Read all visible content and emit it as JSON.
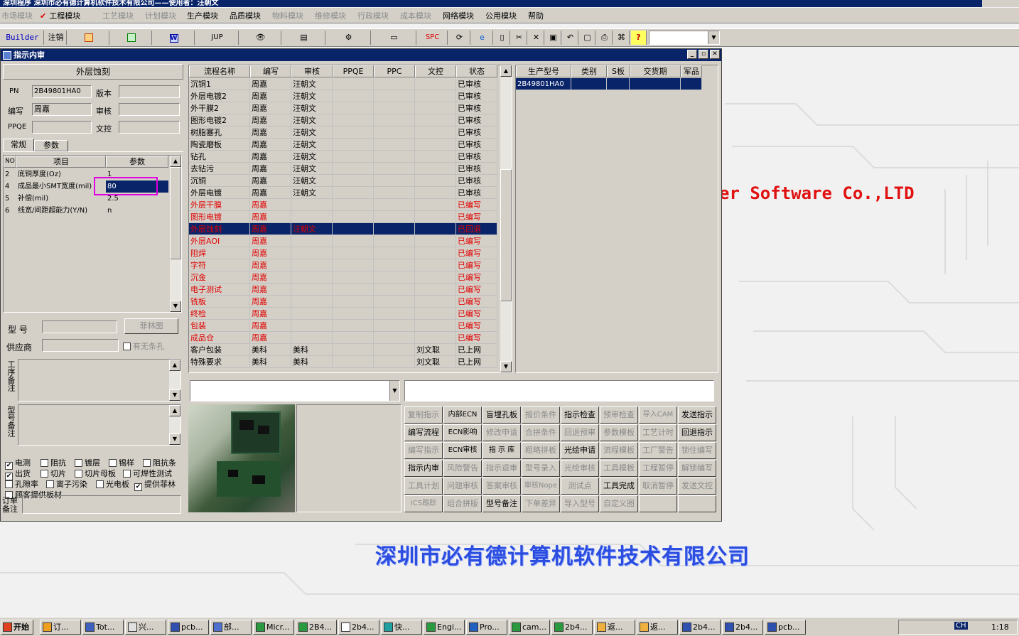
{
  "app": {
    "title": "深圳程序  深圳市必有德计算机软件技术有限公司——使用者：汪朝文"
  },
  "menu": [
    {
      "label": "市场模块",
      "dim": true
    },
    {
      "label": "工程模块",
      "dim": false,
      "checked": true
    },
    {
      "label": "工艺模块",
      "dim": true
    },
    {
      "label": "计划模块",
      "dim": true
    },
    {
      "label": "生产模块",
      "dim": false
    },
    {
      "label": "品质模块",
      "dim": false
    },
    {
      "label": "物料模块",
      "dim": true
    },
    {
      "label": "维修模块",
      "dim": true
    },
    {
      "label": "行政模块",
      "dim": true
    },
    {
      "label": "成本模块",
      "dim": true
    },
    {
      "label": "网络模块",
      "dim": false
    },
    {
      "label": "公用模块",
      "dim": false
    },
    {
      "label": "帮助",
      "dim": false
    }
  ],
  "toolbar": {
    "builder": "Builder",
    "logout": "注销",
    "jup": "JUP",
    "spc": "SPC",
    "icons": [
      "excel-icon",
      "excel2-icon",
      "word-icon",
      "eye-icon",
      "database-icon",
      "network-icon",
      "printer-icon",
      "refresh-icon",
      "ie-icon",
      "new-file-icon",
      "cut-icon",
      "close-x-icon",
      "save-icon",
      "undo-icon",
      "preview-icon",
      "print-icon",
      "binoculars-icon",
      "help-icon"
    ]
  },
  "child_window": {
    "title": "指示内审"
  },
  "left": {
    "section_title": "外层蚀刻",
    "pn_label": "PN",
    "pn_value": "2B49801HA0",
    "version_label": "版本",
    "writer_label": "编写",
    "writer_value": "周嘉",
    "reviewer_label": "审核",
    "ppqe_label": "PPQE",
    "proofread_label": "文控",
    "tabs": [
      "常规",
      "参数"
    ],
    "param_headers": [
      "NO",
      "项目",
      "参数"
    ],
    "params": [
      {
        "no": "2",
        "item": "底铜厚度(Oz)",
        "value": "1"
      },
      {
        "no": "4",
        "item": "成品最小SMT宽度(mil)",
        "value": "80"
      },
      {
        "no": "5",
        "item": "补偿(mil)",
        "value": "2.5"
      },
      {
        "no": "6",
        "item": "线宽/间距超能力(Y/N)",
        "value": "n"
      }
    ],
    "model_label": "型  号",
    "film_button": "菲林图",
    "supplier_label": "供应商",
    "no_slot_hole": "有无条孔",
    "process_note_label": "工序备注",
    "model_note_label": "型号备注",
    "order_note_label": "订单备注",
    "checks": [
      {
        "label": "电测",
        "checked": true
      },
      {
        "label": "阻抗",
        "checked": false
      },
      {
        "label": "镀层",
        "checked": false
      },
      {
        "label": "锡样",
        "checked": false
      },
      {
        "label": "阻抗条",
        "checked": false
      },
      {
        "label": "出货",
        "checked": true
      },
      {
        "label": "切片",
        "checked": false
      },
      {
        "label": "切片母板",
        "checked": false
      },
      {
        "label": "可焊性测试",
        "checked": false
      },
      {
        "label": "孔隙率",
        "checked": false
      },
      {
        "label": "离子污染",
        "checked": false
      },
      {
        "label": "光电板",
        "checked": false
      },
      {
        "label": "提供菲林",
        "checked": true
      },
      {
        "label": "顾客提供板材",
        "checked": false
      }
    ]
  },
  "process_grid": {
    "headers": [
      "流程名称",
      "编写",
      "审核",
      "PPQE",
      "PPC",
      "文控",
      "状态"
    ],
    "rows": [
      {
        "name": "沉铜1",
        "writer": "周嘉",
        "reviewer": "汪朝文",
        "ppqe": "",
        "ppc": "",
        "doc": "",
        "status": "已审核",
        "red": false
      },
      {
        "name": "外层电镀2",
        "writer": "周嘉",
        "reviewer": "汪朝文",
        "ppqe": "",
        "ppc": "",
        "doc": "",
        "status": "已审核",
        "red": false
      },
      {
        "name": "外干膜2",
        "writer": "周嘉",
        "reviewer": "汪朝文",
        "ppqe": "",
        "ppc": "",
        "doc": "",
        "status": "已审核",
        "red": false
      },
      {
        "name": "图形电镀2",
        "writer": "周嘉",
        "reviewer": "汪朝文",
        "ppqe": "",
        "ppc": "",
        "doc": "",
        "status": "已审核",
        "red": false
      },
      {
        "name": "树脂塞孔",
        "writer": "周嘉",
        "reviewer": "汪朝文",
        "ppqe": "",
        "ppc": "",
        "doc": "",
        "status": "已审核",
        "red": false
      },
      {
        "name": "陶瓷磨板",
        "writer": "周嘉",
        "reviewer": "汪朝文",
        "ppqe": "",
        "ppc": "",
        "doc": "",
        "status": "已审核",
        "red": false
      },
      {
        "name": "钻孔",
        "writer": "周嘉",
        "reviewer": "汪朝文",
        "ppqe": "",
        "ppc": "",
        "doc": "",
        "status": "已审核",
        "red": false
      },
      {
        "name": "去钻污",
        "writer": "周嘉",
        "reviewer": "汪朝文",
        "ppqe": "",
        "ppc": "",
        "doc": "",
        "status": "已审核",
        "red": false
      },
      {
        "name": "沉铜",
        "writer": "周嘉",
        "reviewer": "汪朝文",
        "ppqe": "",
        "ppc": "",
        "doc": "",
        "status": "已审核",
        "red": false
      },
      {
        "name": "外层电镀",
        "writer": "周嘉",
        "reviewer": "汪朝文",
        "ppqe": "",
        "ppc": "",
        "doc": "",
        "status": "已审核",
        "red": false
      },
      {
        "name": "外层干膜",
        "writer": "周嘉",
        "reviewer": "",
        "ppqe": "",
        "ppc": "",
        "doc": "",
        "status": "已编写",
        "red": true
      },
      {
        "name": "图形电镀",
        "writer": "周嘉",
        "reviewer": "",
        "ppqe": "",
        "ppc": "",
        "doc": "",
        "status": "已编写",
        "red": true
      },
      {
        "name": "外层蚀刻",
        "writer": "周嘉",
        "reviewer": "汪朝文",
        "ppqe": "",
        "ppc": "",
        "doc": "",
        "status": "已回退",
        "red": true,
        "selected": true
      },
      {
        "name": "外层AOI",
        "writer": "周嘉",
        "reviewer": "",
        "ppqe": "",
        "ppc": "",
        "doc": "",
        "status": "已编写",
        "red": true
      },
      {
        "name": "阻焊",
        "writer": "周嘉",
        "reviewer": "",
        "ppqe": "",
        "ppc": "",
        "doc": "",
        "status": "已编写",
        "red": true
      },
      {
        "name": "字符",
        "writer": "周嘉",
        "reviewer": "",
        "ppqe": "",
        "ppc": "",
        "doc": "",
        "status": "已编写",
        "red": true
      },
      {
        "name": "沉金",
        "writer": "周嘉",
        "reviewer": "",
        "ppqe": "",
        "ppc": "",
        "doc": "",
        "status": "已编写",
        "red": true
      },
      {
        "name": "电子测试",
        "writer": "周嘉",
        "reviewer": "",
        "ppqe": "",
        "ppc": "",
        "doc": "",
        "status": "已编写",
        "red": true
      },
      {
        "name": "铣板",
        "writer": "周嘉",
        "reviewer": "",
        "ppqe": "",
        "ppc": "",
        "doc": "",
        "status": "已编写",
        "red": true
      },
      {
        "name": "终检",
        "writer": "周嘉",
        "reviewer": "",
        "ppqe": "",
        "ppc": "",
        "doc": "",
        "status": "已编写",
        "red": true
      },
      {
        "name": "包装",
        "writer": "周嘉",
        "reviewer": "",
        "ppqe": "",
        "ppc": "",
        "doc": "",
        "status": "已编写",
        "red": true
      },
      {
        "name": "成品仓",
        "writer": "周嘉",
        "reviewer": "",
        "ppqe": "",
        "ppc": "",
        "doc": "",
        "status": "已编写",
        "red": true
      },
      {
        "name": "客户包装",
        "writer": "美科",
        "reviewer": "美科",
        "ppqe": "",
        "ppc": "",
        "doc": "刘文聪",
        "status": "已上网",
        "red": false
      },
      {
        "name": "特殊要求",
        "writer": "美科",
        "reviewer": "美科",
        "ppqe": "",
        "ppc": "",
        "doc": "刘文聪",
        "status": "已上网",
        "red": false
      }
    ]
  },
  "product_grid": {
    "headers": [
      "生产型号",
      "类别",
      "S板",
      "交货期",
      "军品"
    ],
    "rows": [
      {
        "model": "2B49801HA0",
        "cat": "",
        "s": "",
        "date": "",
        "mil": ""
      }
    ]
  },
  "buttons": [
    [
      "复制指示",
      "内部ECN",
      "盲埋孔板",
      "报价条件",
      "指示检查",
      "预审检查",
      "导入CAM",
      "发送指示"
    ],
    [
      "编写流程",
      "ECN影响",
      "修改申请",
      "合拼条件",
      "回退预审",
      "参数模板",
      "工艺计时",
      "回退指示"
    ],
    [
      "编写指示",
      "ECN审核",
      "指 示 库",
      "粗略拼板",
      "光绘申请",
      "流程模板",
      "工厂警告",
      "锁住编写"
    ],
    [
      "指示内审",
      "风险警告",
      "指示退审",
      "型号录入",
      "光绘审核",
      "工具模板",
      "工程暂停",
      "解锁编写"
    ],
    [
      "工具计划",
      "问题审核",
      "答案审核",
      "审核Nope",
      "测试点",
      "工具完成",
      "取消暂停",
      "发送文控"
    ],
    [
      "ICS跟踪",
      "组合拼版",
      "型号备注",
      "下单差异",
      "导入型号",
      "自定义图",
      "",
      ""
    ]
  ],
  "buttons_enabled": [
    [
      false,
      true,
      true,
      false,
      true,
      false,
      false,
      true
    ],
    [
      true,
      true,
      false,
      false,
      false,
      false,
      false,
      true
    ],
    [
      false,
      true,
      true,
      false,
      true,
      false,
      false,
      false
    ],
    [
      true,
      false,
      false,
      false,
      false,
      false,
      false,
      false
    ],
    [
      false,
      false,
      false,
      false,
      false,
      true,
      false,
      false
    ],
    [
      false,
      false,
      true,
      false,
      false,
      false,
      false,
      false
    ]
  ],
  "background": {
    "company_en": "er Software Co.,LTD",
    "company_cn": "深圳市必有德计算机软件技术有限公司"
  },
  "taskbar": {
    "start": "开始",
    "tasks": [
      "订...",
      "Tot...",
      "兴...",
      "pcb...",
      "部...",
      "Micr...",
      "2B4...",
      "2b4...",
      "快...",
      "Engi...",
      "Pro...",
      "cam...",
      "2b4...",
      "返...",
      "返...",
      "2b4...",
      "2b4...",
      "pcb..."
    ],
    "ime": "CH",
    "clock": "1:18"
  },
  "colors": {
    "titlebar": "#0a246a",
    "face": "#d4d0c8",
    "red_text": "#e00000",
    "highlight_box": "#e000e0"
  }
}
